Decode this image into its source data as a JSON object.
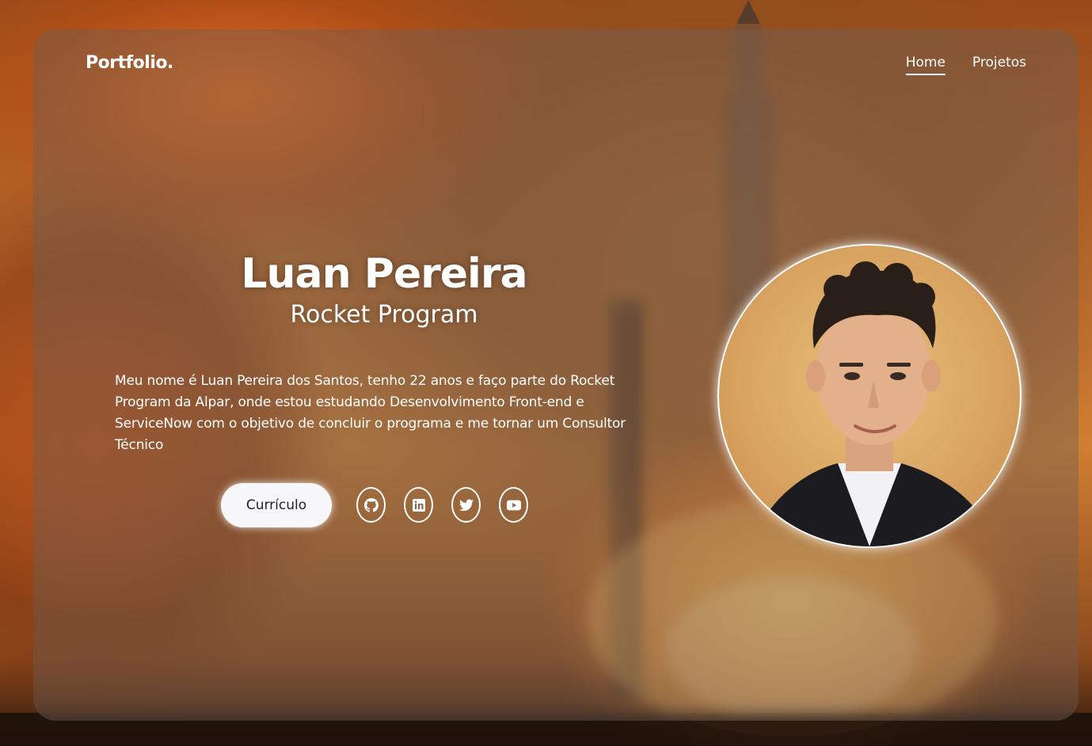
{
  "header": {
    "logo": "Portfolio.",
    "nav": [
      {
        "label": "Home",
        "active": true
      },
      {
        "label": "Projetos",
        "active": false
      }
    ]
  },
  "hero": {
    "name": "Luan Pereira",
    "subtitle": "Rocket Program",
    "bio": "Meu nome é Luan Pereira dos Santos, tenho 22 anos e faço parte do Rocket Program da Alpar, onde estou estudando Desenvolvimento Front-end e ServiceNow com o objetivo de concluir o programa e me tornar um Consultor Técnico",
    "cv_button": "Currículo"
  },
  "socials": [
    {
      "icon": "github-icon"
    },
    {
      "icon": "linkedin-icon"
    },
    {
      "icon": "twitter-icon"
    },
    {
      "icon": "youtube-icon"
    }
  ],
  "colors": {
    "accent": "#ffffff",
    "button_bg": "#f7f7f9",
    "card_overlay": "rgba(110,95,85,0.42)"
  }
}
